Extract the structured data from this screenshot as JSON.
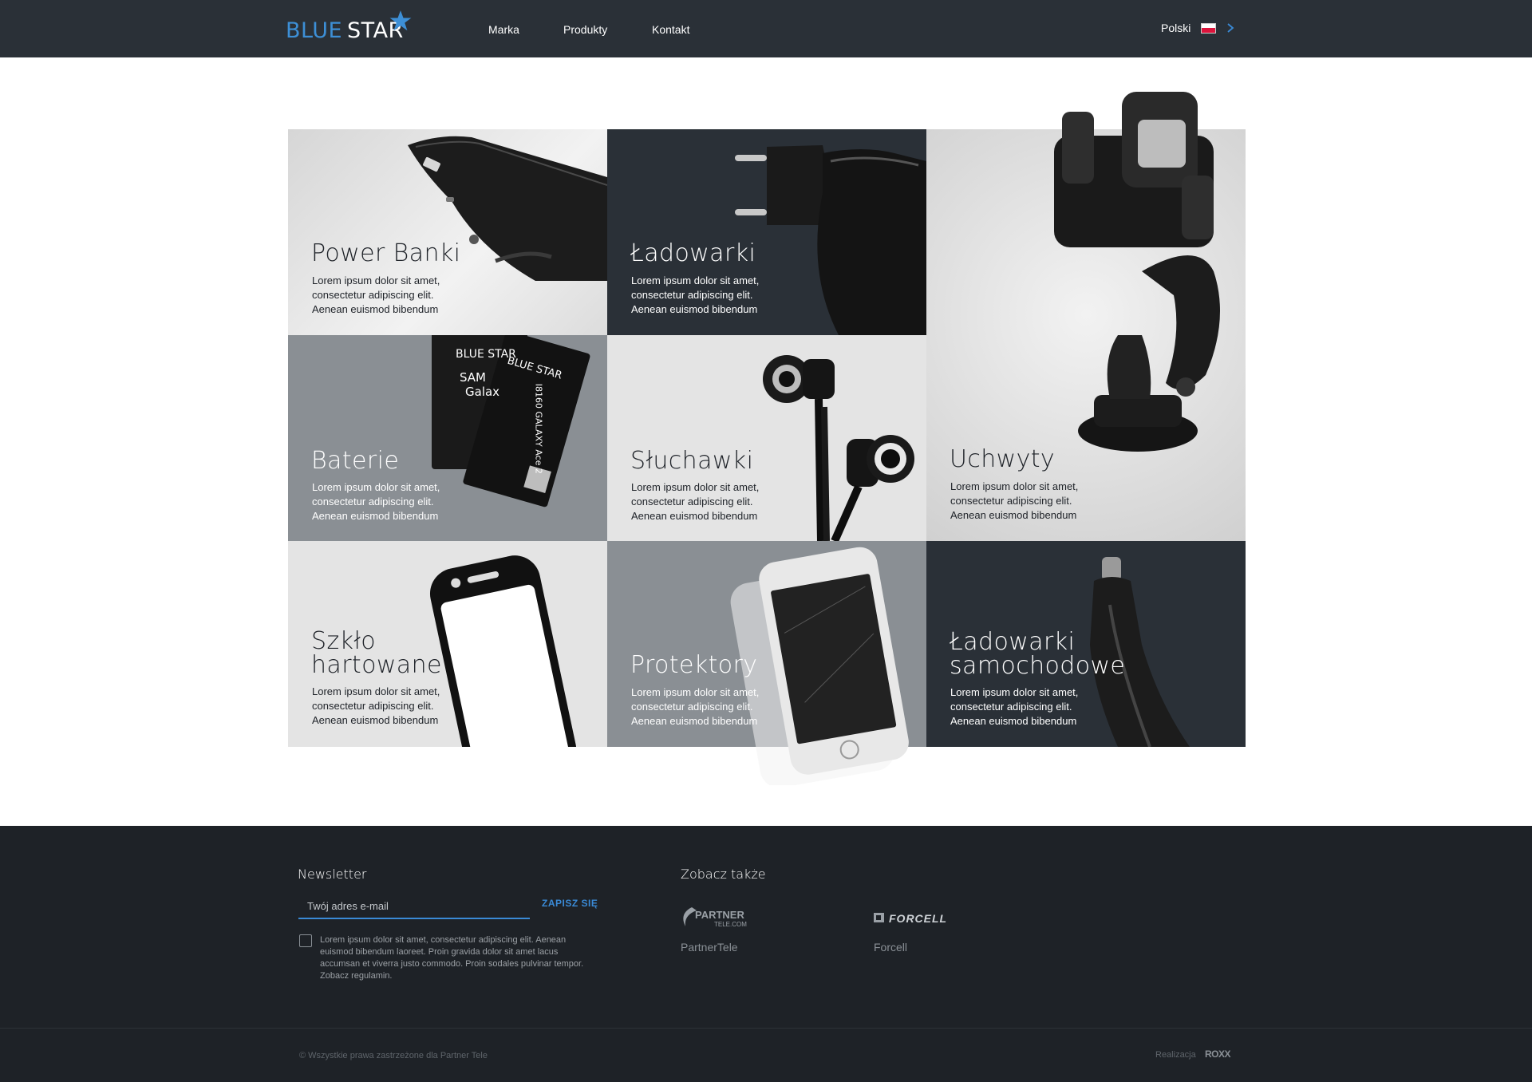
{
  "header": {
    "logo_blue": "BLUE",
    "logo_white": "STAR",
    "nav": [
      {
        "label": "Marka"
      },
      {
        "label": "Produkty"
      },
      {
        "label": "Kontakt"
      }
    ],
    "language": "Polski"
  },
  "tiles": [
    {
      "title": "Power Banki",
      "desc": "Lorem ipsum dolor sit amet, consectetur adipiscing elit. Aenean euismod bibendum"
    },
    {
      "title": "Ładowarki",
      "desc": "Lorem ipsum dolor sit amet, consectetur adipiscing elit. Aenean euismod bibendum"
    },
    {
      "title": "Uchwyty",
      "desc": "Lorem ipsum dolor sit amet, consectetur adipiscing elit. Aenean euismod bibendum"
    },
    {
      "title": "Baterie",
      "desc": "Lorem ipsum dolor sit amet, consectetur adipiscing elit. Aenean euismod bibendum"
    },
    {
      "title": "Słuchawki",
      "desc": "Lorem ipsum dolor sit amet, consectetur adipiscing elit. Aenean euismod bibendum"
    },
    {
      "title_line1": "Szkło",
      "title_line2": "hartowane",
      "desc": "Lorem ipsum dolor sit amet, consectetur adipiscing elit. Aenean euismod bibendum"
    },
    {
      "title": "Protektory",
      "desc": "Lorem ipsum dolor sit amet, consectetur adipiscing elit. Aenean euismod bibendum"
    },
    {
      "title_line1": "Ładowarki",
      "title_line2": "samochodowe",
      "desc": "Lorem ipsum dolor sit amet, consectetur adipiscing elit. Aenean euismod bibendum"
    }
  ],
  "battery_print": {
    "brand": "BLUE STAR",
    "model_a": "SAM",
    "model_b": "Galax",
    "model_c": "I8160 GALAXY Ace 2"
  },
  "footer": {
    "newsletter_heading": "Newsletter",
    "email_placeholder": "Twój adres e-mail",
    "subscribe_label": "ZAPISZ SIĘ",
    "consent_text": "Lorem ipsum dolor sit amet, consectetur adipiscing elit. Aenean euismod bibendum laoreet. Proin gravida dolor sit amet lacus accumsan et viverra justo commodo. Proin sodales pulvinar tempor. Zobacz regulamin.",
    "see_also_heading": "Zobacz także",
    "partners": [
      {
        "name": "PartnerTele",
        "logo_text": "PARTNER",
        "logo_sub": "TELE.COM"
      },
      {
        "name": "Forcell",
        "logo_text": "FORCELL"
      }
    ],
    "copyright": "© Wszystkie prawa zastrzeżone dla Partner Tele",
    "credit_label": "Realizacja",
    "credit_brand": "ROXX"
  },
  "colors": {
    "header_bg": "#2a3037",
    "accent_blue": "#3a8ad6",
    "tile_dark": "#2a3037",
    "tile_mid": "#8a8f94",
    "tile_light": "#e4e4e4",
    "footer_bg": "#1e2227"
  },
  "icons": [
    "star-icon",
    "poland-flag-icon",
    "chevron-right-icon",
    "checkbox-icon"
  ]
}
